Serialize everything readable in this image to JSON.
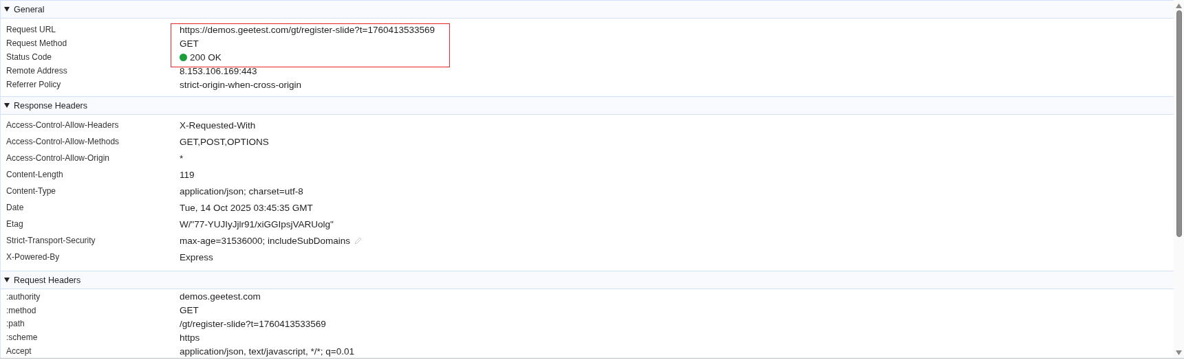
{
  "sections": [
    {
      "title": "General",
      "expanded": true,
      "kind": "general",
      "rows": [
        {
          "name": "Request URL",
          "value": "https://demos.geetest.com/gt/register-slide?t=1760413533569",
          "highlighted": true
        },
        {
          "name": "Request Method",
          "value": "GET",
          "highlighted": true
        },
        {
          "name": "Status Code",
          "value": "200 OK",
          "highlighted": true,
          "color": "#1a9e3a"
        },
        {
          "name": "Remote Address",
          "value": "8.153.106.169:443",
          "highlighted": false
        },
        {
          "name": "Referrer Policy",
          "value": "strict-origin-when-cross-origin",
          "highlighted": false
        }
      ]
    },
    {
      "title": "Response Headers",
      "expanded": true,
      "kind": "response",
      "rows": [
        {
          "name": "Access-Control-Allow-Headers",
          "value": "X-Requested-With",
          "editable": false
        },
        {
          "name": "Access-Control-Allow-Methods",
          "value": "GET,POST,OPTIONS",
          "editable": false
        },
        {
          "name": "Access-Control-Allow-Origin",
          "value": "*",
          "editable": false
        },
        {
          "name": "Content-Length",
          "value": "119",
          "editable": false
        },
        {
          "name": "Content-Type",
          "value": "application/json; charset=utf-8",
          "editable": false
        },
        {
          "name": "Date",
          "value": "Tue, 14 Oct 2025 03:45:35 GMT",
          "editable": false
        },
        {
          "name": "Etag",
          "value": "W/\"77-YUJIyJjlr91/xiGGIpsjVARUolg\"",
          "editable": false
        },
        {
          "name": "Strict-Transport-Security",
          "value": "max-age=31536000; includeSubDomains",
          "editable": true
        },
        {
          "name": "X-Powered-By",
          "value": "Express",
          "editable": false
        }
      ]
    },
    {
      "title": "Request Headers",
      "expanded": true,
      "kind": "request",
      "rows": [
        {
          "name": ":authority",
          "value": "demos.geetest.com"
        },
        {
          "name": ":method",
          "value": "GET"
        },
        {
          "name": ":path",
          "value": "/gt/register-slide?t=1760413533569"
        },
        {
          "name": ":scheme",
          "value": "https"
        },
        {
          "name": "Accept",
          "value": "application/json, text/javascript, */*; q=0.01"
        }
      ]
    }
  ]
}
